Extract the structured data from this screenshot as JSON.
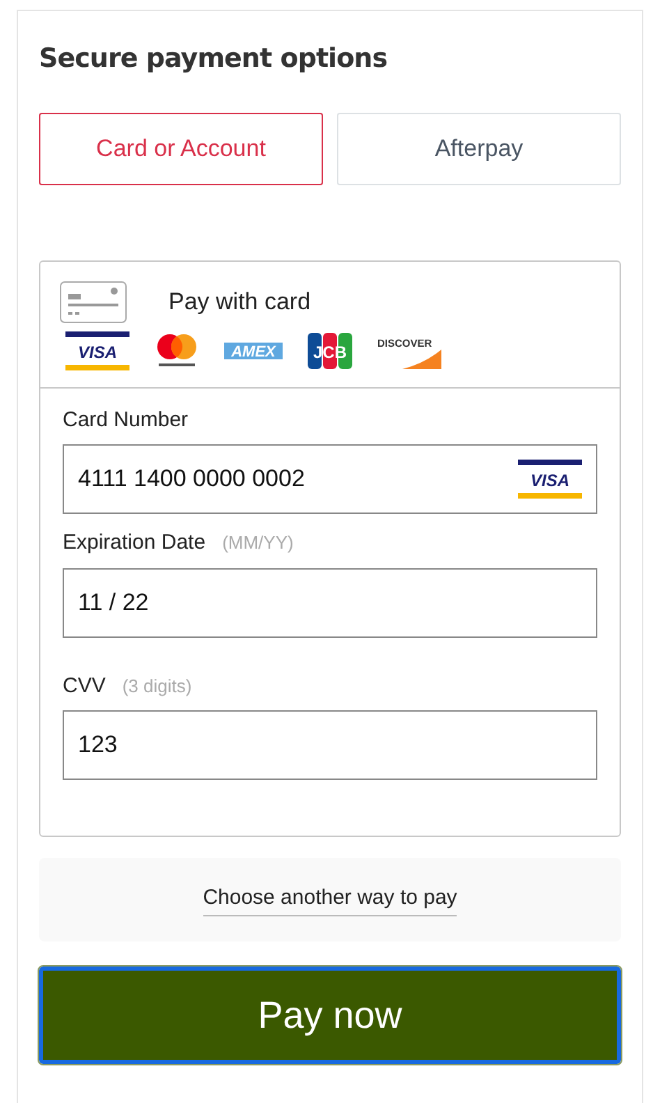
{
  "title": "Secure payment options",
  "tabs": [
    {
      "label": "Card or Account",
      "selected": true
    },
    {
      "label": "Afterpay",
      "selected": false
    }
  ],
  "card_panel": {
    "heading": "Pay with card",
    "brands": [
      {
        "kind": "visa",
        "label": "VISA"
      },
      {
        "kind": "mastercard"
      },
      {
        "kind": "amex",
        "label": "AMEX"
      },
      {
        "kind": "jcb",
        "label": "JCB"
      },
      {
        "kind": "discover",
        "label": "DISCOVER"
      }
    ],
    "fields": [
      {
        "label": "Card Number",
        "value": "4111 1400 0000 0002",
        "badge": "VISA"
      },
      {
        "label": "Expiration Date",
        "hint": "(MM/YY)",
        "value": "11 / 22"
      },
      {
        "label": "CVV",
        "hint": "(3 digits)",
        "value": "123"
      }
    ]
  },
  "alternative_link": "Choose another way to pay",
  "pay_button": "Pay now"
}
